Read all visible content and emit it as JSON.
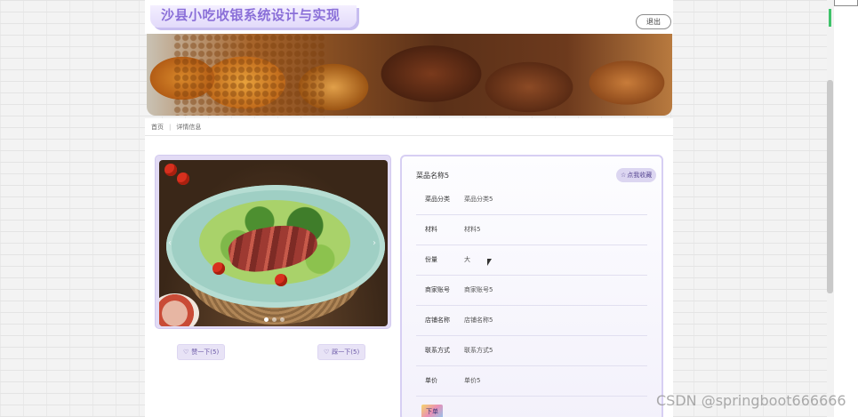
{
  "header": {
    "title": "沙县小吃收银系统设计与实现",
    "logout_label": "退出"
  },
  "breadcrumb": {
    "items": [
      "首页",
      "详情信息"
    ]
  },
  "carousel": {
    "dot_count": 3,
    "active_index": 0
  },
  "votes": {
    "up_label": "赞一下(5)",
    "down_label": "踩一下(5)"
  },
  "detail": {
    "dish_name": "菜品名称5",
    "favorite_label": "点我收藏",
    "rows": [
      {
        "label": "菜品分类",
        "value": "菜品分类5"
      },
      {
        "label": "材料",
        "value": "材料5"
      },
      {
        "label": "份量",
        "value": "大"
      },
      {
        "label": "商家账号",
        "value": "商家账号5"
      },
      {
        "label": "店铺名称",
        "value": "店铺名称5"
      },
      {
        "label": "联系方式",
        "value": "联系方式5"
      },
      {
        "label": "单价",
        "value": "单价5"
      }
    ],
    "order_label": "下单"
  },
  "watermark": "CSDN @springboot666666",
  "colors": {
    "accent": "#8a6fd8",
    "panel_border": "#d7cff3",
    "button_bg": "#e8e3f6"
  },
  "icons": {
    "up": "thumb-up-icon",
    "down": "thumb-down-icon",
    "favorite": "star-icon"
  }
}
